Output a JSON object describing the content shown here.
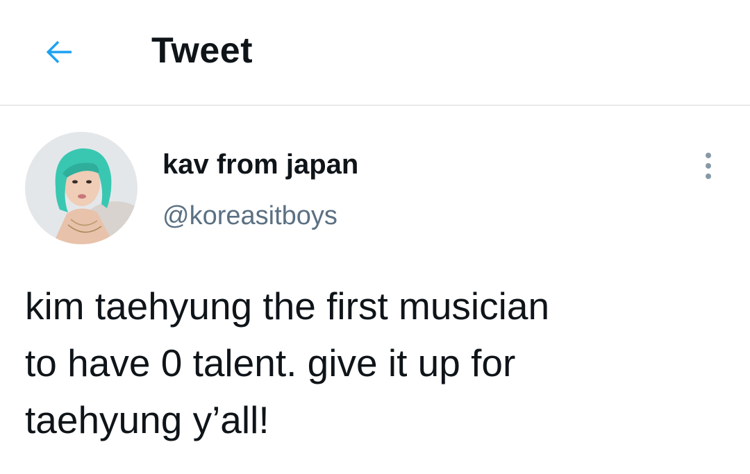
{
  "header": {
    "title": "Tweet",
    "back_icon": "arrow-left-icon",
    "accent_color": "#1da1f2"
  },
  "tweet": {
    "author": {
      "display_name": "kav from japan",
      "handle": "@koreasitboys",
      "avatar_icon": "profile-photo"
    },
    "more_icon": "more-vertical-icon",
    "text": "kim taehyung the first musician\nto have 0 talent. give it up for\ntaehyung y’all!"
  },
  "colors": {
    "text_primary": "#0f1419",
    "text_secondary": "#5b7083",
    "divider": "#d6d6d6",
    "background": "#ffffff"
  }
}
